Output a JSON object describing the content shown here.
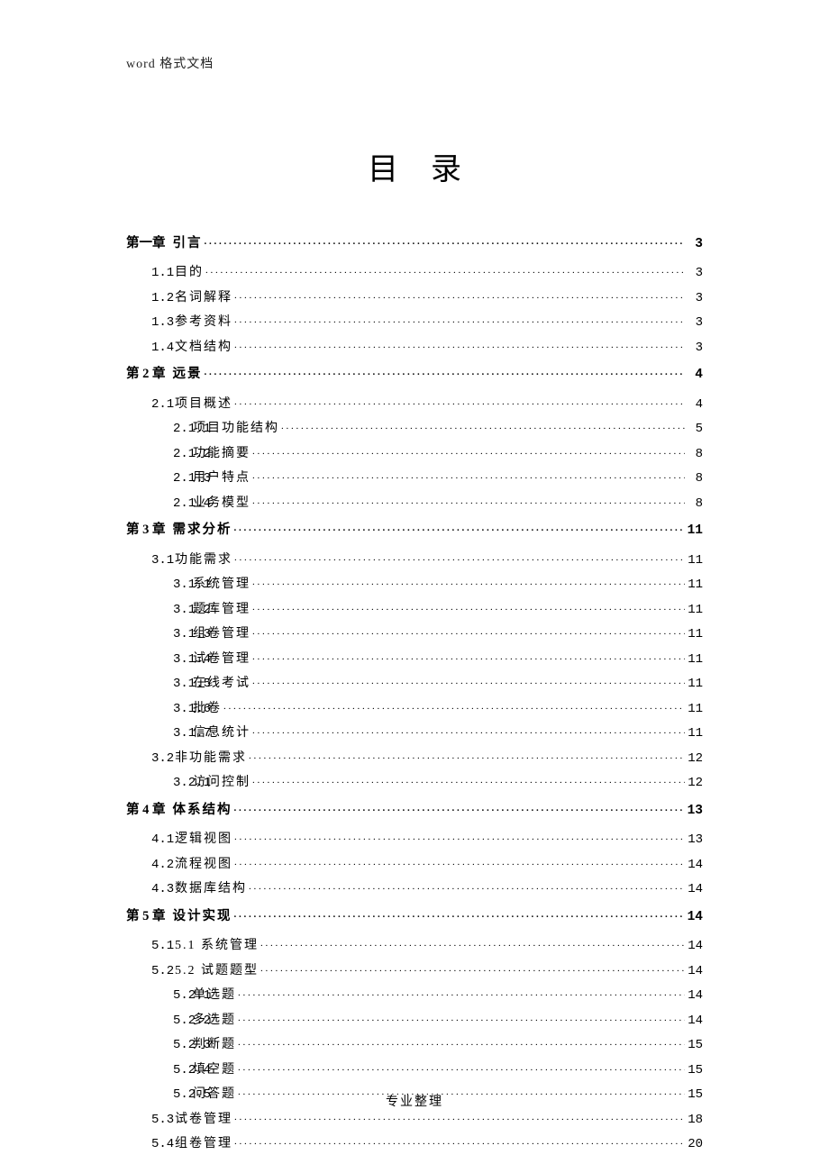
{
  "header_note": "word 格式文档",
  "title": "目录",
  "footer": "专业整理",
  "toc": [
    {
      "level": 0,
      "num": "第一章",
      "label": "引言",
      "page": "3"
    },
    {
      "level": 1,
      "num": "1.1",
      "label": "目的",
      "page": "3"
    },
    {
      "level": 1,
      "num": "1.2",
      "label": "名词解释",
      "page": "3"
    },
    {
      "level": 1,
      "num": "1.3",
      "label": "参考资料",
      "page": "3"
    },
    {
      "level": 1,
      "num": "1.4",
      "label": "文档结构",
      "page": "3"
    },
    {
      "level": 0,
      "num": "第 2 章",
      "label": "远景",
      "page": "4"
    },
    {
      "level": 1,
      "num": "2.1",
      "label": "项目概述",
      "page": "4"
    },
    {
      "level": 2,
      "num": "2.1.1",
      "label": "项目功能结构",
      "page": "5"
    },
    {
      "level": 2,
      "num": "2.1.2",
      "label": "功能摘要",
      "page": "8"
    },
    {
      "level": 2,
      "num": "2.1.3",
      "label": "用户特点",
      "page": "8"
    },
    {
      "level": 2,
      "num": "2.1.4",
      "label": "业务模型",
      "page": "8"
    },
    {
      "level": 0,
      "num": "第 3 章",
      "label": "需求分析",
      "page": "11"
    },
    {
      "level": 1,
      "num": "3.1",
      "label": "功能需求",
      "page": "11"
    },
    {
      "level": 2,
      "num": "3.1.1",
      "label": "系统管理",
      "page": "11"
    },
    {
      "level": 2,
      "num": "3.1.2",
      "label": "题库管理",
      "page": "11"
    },
    {
      "level": 2,
      "num": "3.1.3",
      "label": "组卷管理",
      "page": "11"
    },
    {
      "level": 2,
      "num": "3.1.4",
      "label": "试卷管理",
      "page": "11"
    },
    {
      "level": 2,
      "num": "3.1.5",
      "label": "在线考试",
      "page": "11"
    },
    {
      "level": 2,
      "num": "3.1.6",
      "label": "批卷",
      "page": "11"
    },
    {
      "level": 2,
      "num": "3.1.7",
      "label": "信息统计",
      "page": "11"
    },
    {
      "level": 1,
      "num": "3.2",
      "label": "非功能需求",
      "page": "12"
    },
    {
      "level": 2,
      "num": "3.2.1",
      "label": "访问控制",
      "page": "12"
    },
    {
      "level": 0,
      "num": "第 4 章",
      "label": "体系结构",
      "page": "13"
    },
    {
      "level": 1,
      "num": "4.1",
      "label": "逻辑视图",
      "page": "13"
    },
    {
      "level": 1,
      "num": "4.2",
      "label": "流程视图",
      "page": "14"
    },
    {
      "level": 1,
      "num": "4.3",
      "label": "数据库结构",
      "page": "14"
    },
    {
      "level": 0,
      "num": "第 5 章",
      "label": "设计实现",
      "page": "14"
    },
    {
      "level": 1,
      "num": "5.1",
      "label": "5.1 系统管理",
      "page": "14"
    },
    {
      "level": 1,
      "num": "5.2",
      "label": "5.2 试题题型",
      "page": "14"
    },
    {
      "level": 2,
      "num": "5.2.1",
      "label": "单选题",
      "page": "14"
    },
    {
      "level": 2,
      "num": "5.2.2",
      "label": "多选题",
      "page": "14"
    },
    {
      "level": 2,
      "num": "5.2.3",
      "label": "判断题",
      "page": "15"
    },
    {
      "level": 2,
      "num": "5.2.4",
      "label": "填空题",
      "page": "15"
    },
    {
      "level": 2,
      "num": "5.2.5",
      "label": "问答题",
      "page": "15"
    },
    {
      "level": 1,
      "num": "5.3",
      "label": "试卷管理",
      "page": "18"
    },
    {
      "level": 1,
      "num": "5.4",
      "label": "组卷管理",
      "page": "20"
    }
  ]
}
